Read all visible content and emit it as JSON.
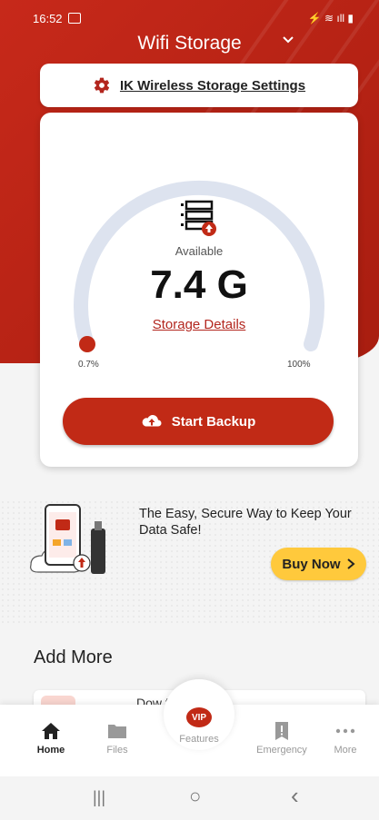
{
  "status_bar": {
    "time": "16:52",
    "icons_right": "⚡ ≋ ıll ▮"
  },
  "header": {
    "title": "Wifi Storage",
    "dropdown_icon": "chevron-down-icon"
  },
  "settings": {
    "label": "IK Wireless Storage Settings",
    "icon": "gear-icon"
  },
  "storage": {
    "available_label": "Available",
    "value": "7.4 G",
    "details_label": "Storage Details",
    "min_label": "0.7%",
    "max_label": "100%",
    "used_fraction": 0.007
  },
  "backup": {
    "label": "Start Backup",
    "icon": "cloud-upload-icon"
  },
  "promo": {
    "text": "The Easy, Secure Way to Keep Your Data Safe!",
    "buy_label": "Buy Now",
    "buy_icon": "chevron-right-icon"
  },
  "add_more": {
    "title": "Add More",
    "card_text": "Dow            finitiKloud"
  },
  "nav": {
    "items": [
      {
        "label": "Home",
        "icon": "home-icon",
        "active": true
      },
      {
        "label": "Files",
        "icon": "folder-icon",
        "active": false
      },
      {
        "label": "Features",
        "icon": "vip-icon",
        "badge": "VIP",
        "active": false
      },
      {
        "label": "Emergency",
        "icon": "emergency-icon",
        "active": false
      },
      {
        "label": "More",
        "icon": "more-icon",
        "active": false
      }
    ]
  },
  "system_bar": {
    "recent": "|||",
    "home": "○",
    "back": "‹"
  },
  "colors": {
    "brand_red": "#c12a16",
    "accent_yellow": "#ffc93c",
    "gauge_track": "#dde3ef"
  }
}
